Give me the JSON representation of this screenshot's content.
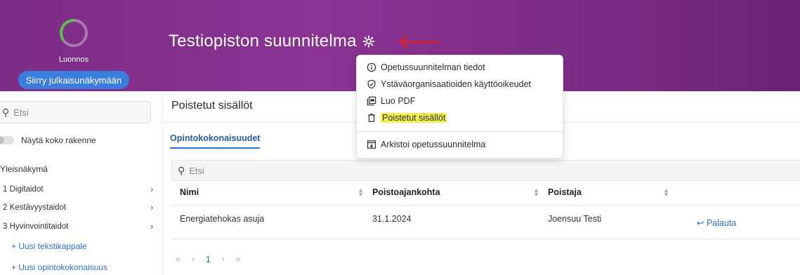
{
  "header": {
    "status_label": "Luonnos",
    "publish_button": "Siirry julkaisunäkymään",
    "plan_title": "Testiopiston suunnitelma",
    "settings_icon": "gear-icon",
    "annotation_arrow_color": "#e02020"
  },
  "dropdown": {
    "items": [
      {
        "label": "Opetussuunnitelman tiedot",
        "icon": "info-icon"
      },
      {
        "label": "Ystäväorganisaatioiden käyttöoikeudet",
        "icon": "shield-check-icon"
      },
      {
        "label": "Luo PDF",
        "icon": "pdf-icon"
      },
      {
        "label": "Poistetut sisällöt",
        "icon": "trash-icon",
        "highlighted": true
      },
      {
        "label": "Arkistoi opetussuunnitelma",
        "icon": "archive-icon"
      }
    ]
  },
  "sidebar": {
    "search_placeholder": "Etsi",
    "show_structure_label": "Näytä koko rakenne",
    "overview_label": "Yleisnäkymä",
    "items": [
      {
        "label": "1 Digitaidot"
      },
      {
        "label": "2 Kestävyystaidot"
      },
      {
        "label": "3 Hyvinvointitaidot"
      }
    ],
    "add_text_paragraph": "+ Uusi tekstikappale",
    "add_study_unit": "+ Uusi opintokokonaisuus"
  },
  "main": {
    "section_title": "Poistetut sisällöt",
    "tab_label": "Opintokokonaisuudet",
    "search_placeholder": "Etsi",
    "columns": [
      "Nimi",
      "Poistoajankohta",
      "Poistaja"
    ],
    "rows": [
      {
        "name": "Energiatehokas asuja",
        "date": "31.1.2024",
        "deleter": "Joensuu Testi",
        "action": "Palauta"
      }
    ],
    "pagination": {
      "first": "«",
      "prev": "‹",
      "current": "1",
      "next": "›",
      "last": "»"
    }
  },
  "colors": {
    "header_purple": "#7c2d86",
    "accent_blue": "#2f6fd1",
    "button_blue": "#3b7ddd",
    "highlight_yellow": "#f6f04a",
    "ring_green": "#5bbf4a"
  }
}
